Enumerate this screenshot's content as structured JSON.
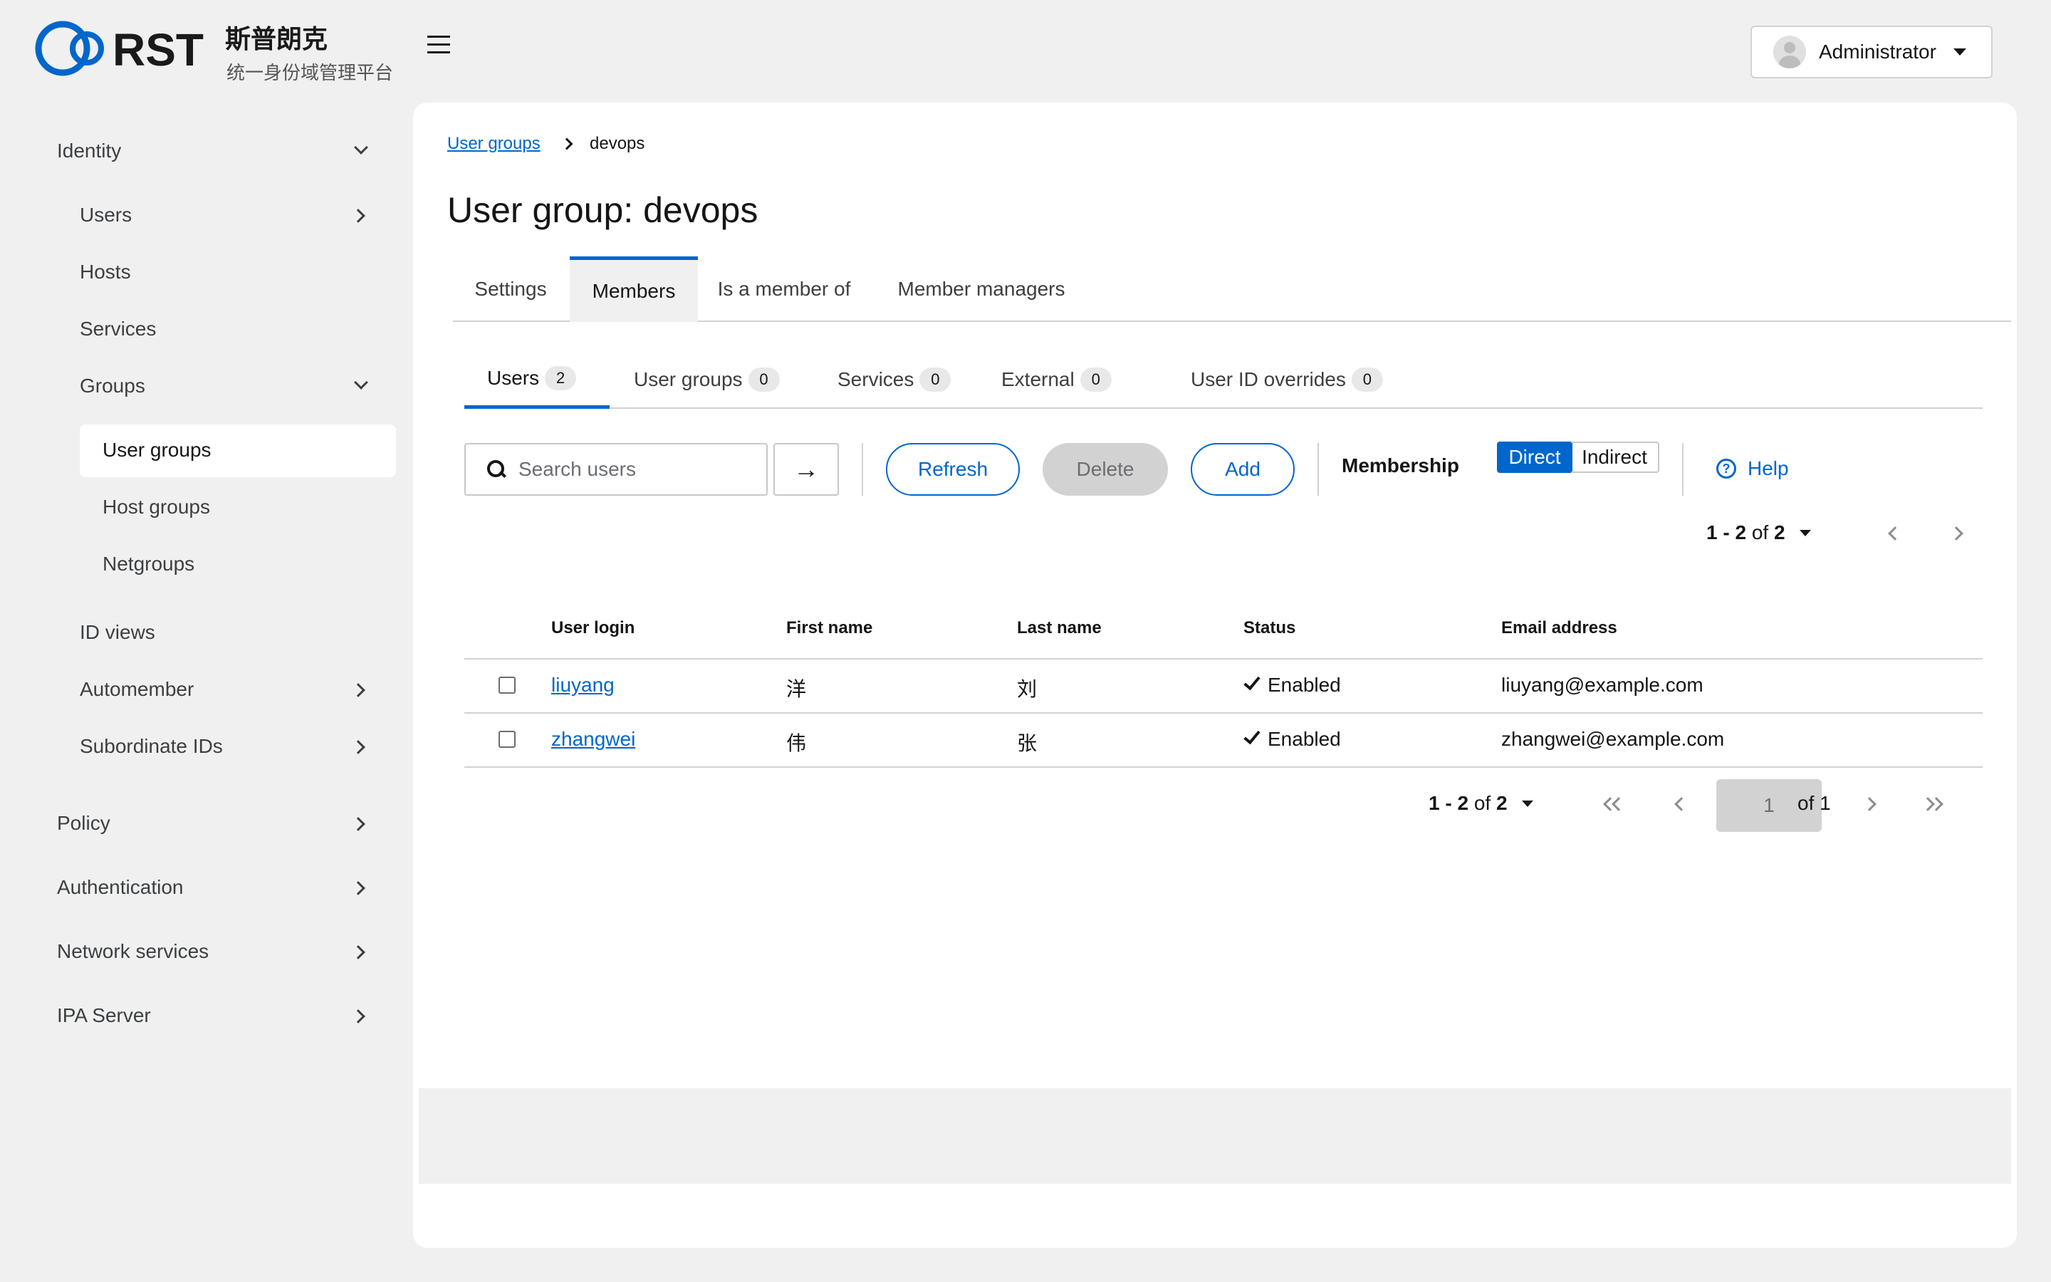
{
  "brand": {
    "logo_text": "RST",
    "name_cn": "斯普朗克",
    "subtitle": "统一身份域管理平台"
  },
  "user_menu": {
    "label": "Administrator"
  },
  "sidebar": {
    "items": [
      {
        "label": "Identity",
        "chevron": "down"
      },
      {
        "label": "Users",
        "chevron": "right"
      },
      {
        "label": "Hosts"
      },
      {
        "label": "Services"
      },
      {
        "label": "Groups",
        "chevron": "down"
      },
      {
        "label": "User groups",
        "active": true
      },
      {
        "label": "Host groups"
      },
      {
        "label": "Netgroups"
      },
      {
        "label": "ID views"
      },
      {
        "label": "Automember",
        "chevron": "right"
      },
      {
        "label": "Subordinate IDs",
        "chevron": "right"
      },
      {
        "label": "Policy",
        "chevron": "right"
      },
      {
        "label": "Authentication",
        "chevron": "right"
      },
      {
        "label": "Network services",
        "chevron": "right"
      },
      {
        "label": "IPA Server",
        "chevron": "right"
      }
    ]
  },
  "breadcrumb": {
    "parent": "User groups",
    "current": "devops"
  },
  "page_title": "User group: devops",
  "tabs": [
    {
      "label": "Settings"
    },
    {
      "label": "Members",
      "active": true
    },
    {
      "label": "Is a member of"
    },
    {
      "label": "Member managers"
    }
  ],
  "subtabs": [
    {
      "label": "Users",
      "count": "2",
      "active": true
    },
    {
      "label": "User groups",
      "count": "0"
    },
    {
      "label": "Services",
      "count": "0"
    },
    {
      "label": "External",
      "count": "0"
    },
    {
      "label": "User ID overrides",
      "count": "0"
    }
  ],
  "toolbar": {
    "search_placeholder": "Search users",
    "refresh_label": "Refresh",
    "delete_label": "Delete",
    "add_label": "Add",
    "membership_label": "Membership",
    "direct_label": "Direct",
    "indirect_label": "Indirect",
    "help_label": "Help"
  },
  "pagination": {
    "range": "1 - 2",
    "of_word": "of",
    "total": "2",
    "current_page": "1",
    "of_pages": "of 1"
  },
  "table": {
    "columns": [
      "User login",
      "First name",
      "Last name",
      "Status",
      "Email address"
    ],
    "rows": [
      {
        "login": "liuyang",
        "first": "洋",
        "last": "刘",
        "status": "Enabled",
        "email": "liuyang@example.com"
      },
      {
        "login": "zhangwei",
        "first": "伟",
        "last": "张",
        "status": "Enabled",
        "email": "zhangwei@example.com"
      }
    ]
  },
  "colors": {
    "accent": "#0066cc",
    "background": "#f0f0f0",
    "card": "#ffffff",
    "disabled": "#d2d2d2"
  }
}
